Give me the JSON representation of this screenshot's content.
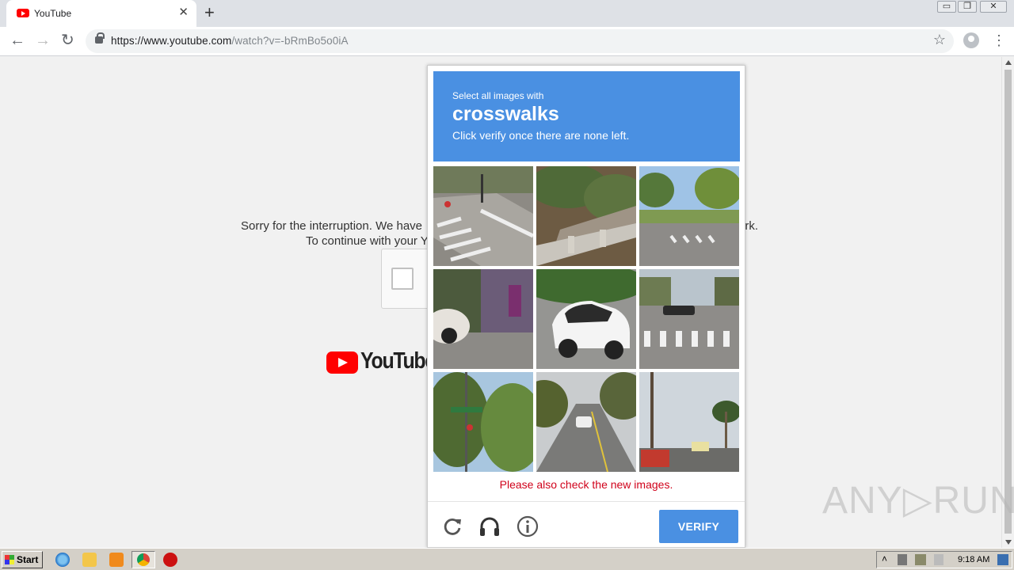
{
  "browser": {
    "tab_title": "YouTube",
    "tab_close": "✕",
    "new_tab": "+",
    "url_host": "https://www.youtube.com",
    "url_path": "/watch?v=-bRmBo5o0iA",
    "back": "←",
    "forward": "→",
    "reload": "↻",
    "star": "☆",
    "menu": "⋮",
    "window_min": "▭",
    "window_restore": "❐",
    "window_close": "✕"
  },
  "page": {
    "sorry_line1": "Sorry for the interruption. We have",
    "sorry_line1_end": "ork.",
    "sorry_line2": "To continue with your Y",
    "logo_text": "YouTube"
  },
  "challenge": {
    "instruction_pre": "Select all images with",
    "target": "crosswalks",
    "instruction_post": "Click verify once there are none left.",
    "error": "Please also check the new images.",
    "verify_label": "VERIFY",
    "tiles": [
      "crosswalk corner sidewalk",
      "rocky hillside guardrail",
      "intersection with trees and crosswalk",
      "car parked near fence",
      "white mini car",
      "crosswalk with cars",
      "trees with street sign",
      "road with cars",
      "palm trees and sign"
    ]
  },
  "watermark": "ANY▷RUN",
  "taskbar": {
    "start": "Start",
    "clock": "9:18 AM"
  }
}
